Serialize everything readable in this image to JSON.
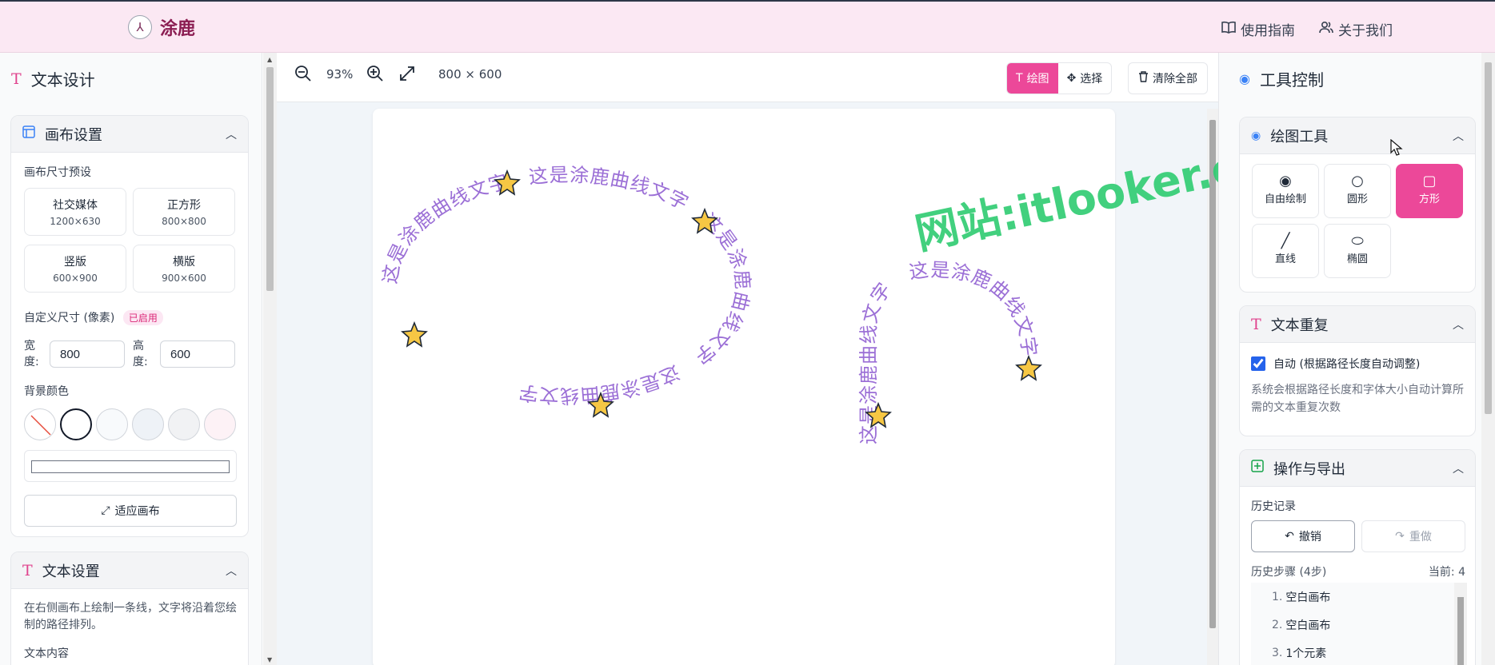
{
  "header": {
    "brand": "涂鹿",
    "logo_glyph": "⅄",
    "links": [
      {
        "label": "使用指南",
        "icon": "book-icon"
      },
      {
        "label": "关于我们",
        "icon": "users-icon"
      }
    ]
  },
  "left": {
    "title": "文本设计",
    "canvas_settings": {
      "title": "画布设置",
      "presets_label": "画布尺寸预设",
      "presets": [
        {
          "name": "社交媒体",
          "size": "1200×630"
        },
        {
          "name": "正方形",
          "size": "800×800"
        },
        {
          "name": "竖版",
          "size": "600×900"
        },
        {
          "name": "横版",
          "size": "900×600"
        }
      ],
      "custom_label": "自定义尺寸 (像素)",
      "custom_badge": "已启用",
      "width_label": "宽度:",
      "width_value": "800",
      "height_label": "高度:",
      "height_value": "600",
      "bg_label": "背景颜色",
      "swatches": [
        "none",
        "#ffffff",
        "#f8fafc",
        "#eef2f7",
        "#f1f2f4",
        "#fdf2f6"
      ],
      "fit_button": "适应画布"
    },
    "text_settings": {
      "title": "文本设置",
      "hint": "在右侧画布上绘制一条线，文字将沿着您绘制的路径排列。",
      "content_label": "文本内容"
    }
  },
  "toolbar": {
    "zoom": "93%",
    "canvas_size": "800 × 600",
    "mode_draw": "绘图",
    "mode_select": "选择",
    "clear_all": "清除全部"
  },
  "canvas": {
    "ellipse_text": "这是涂鹿曲线文字",
    "square_text": "这是涂鹿曲线文字"
  },
  "watermark": "网站:itlooker.cn",
  "right": {
    "title": "工具控制",
    "draw_tools": {
      "title": "绘图工具",
      "tools": [
        {
          "label": "自由绘制",
          "icon": "eye-icon",
          "active": false
        },
        {
          "label": "圆形",
          "icon": "circle-icon",
          "active": false
        },
        {
          "label": "方形",
          "icon": "square-icon",
          "active": true
        },
        {
          "label": "直线",
          "icon": "line-icon",
          "active": false
        },
        {
          "label": "椭圆",
          "icon": "ellipse-icon",
          "active": false
        }
      ]
    },
    "text_repeat": {
      "title": "文本重复",
      "auto_label": "自动 (根据路径长度自动调整)",
      "auto_checked": true,
      "desc": "系统会根据路径长度和字体大小自动计算所需的文本重复次数"
    },
    "ops": {
      "title": "操作与导出",
      "history_label": "历史记录",
      "undo": "撤销",
      "redo": "重做",
      "steps_label": "历史步骤 (4步)",
      "current": "当前: 4",
      "steps": [
        {
          "n": "1.",
          "label": "空白画布"
        },
        {
          "n": "2.",
          "label": "空白画布"
        },
        {
          "n": "3.",
          "label": "1个元素"
        }
      ]
    }
  },
  "colors": {
    "accent": "#ec4899",
    "curve_text": "#9b6fd6",
    "star": "#f6c744",
    "watermark": "#2ecc71"
  }
}
